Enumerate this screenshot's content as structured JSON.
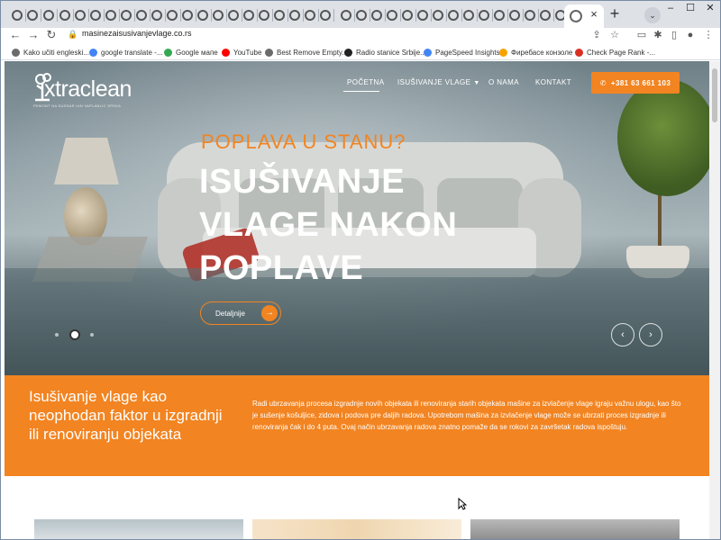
{
  "browser": {
    "url": "masinezaisusivanjevlage.co.rs",
    "new_tab": "+",
    "tab_close": "×",
    "window_controls": [
      "–",
      "☐",
      "✕"
    ],
    "nav": {
      "back": "←",
      "forward": "→",
      "reload": "↻",
      "menu": "⋮"
    }
  },
  "bookmarks": [
    {
      "label": "Kako učiti engleski...",
      "icon": "globe-icon",
      "color": "#6b6b6b"
    },
    {
      "label": "google translate -...",
      "icon": "google-icon",
      "color": "#4285f4"
    },
    {
      "label": "Google мапе",
      "icon": "maps-icon",
      "color": "#34a853"
    },
    {
      "label": "YouTube",
      "icon": "youtube-icon",
      "color": "#ff0000"
    },
    {
      "label": "Best Remove Empty...",
      "icon": "globe-icon",
      "color": "#6b6b6b"
    },
    {
      "label": "Radio stanice Srbije...",
      "icon": "radio-icon",
      "color": "#222222"
    },
    {
      "label": "PageSpeed Insights",
      "icon": "pagespeed-icon",
      "color": "#4285f4"
    },
    {
      "label": "Фиребасе конзоле",
      "icon": "firebase-icon",
      "color": "#f6a300"
    },
    {
      "label": "Check Page Rank -...",
      "icon": "rank-icon",
      "color": "#d93025"
    }
  ],
  "site": {
    "logo_word": "xtraclean",
    "logo_sub": "PEMONT NA SUSSAR IUN VAPLANLIC SPEKA",
    "menu": [
      {
        "label": "POČETNA",
        "active": true
      },
      {
        "label": "ISUŠIVANJE VLAGE",
        "dropdown": true
      },
      {
        "label": "O NAMA"
      },
      {
        "label": "KONTAKT"
      }
    ],
    "phone": "+381 63 661 103",
    "hero": {
      "kicker": "POPLAVA U STANU?",
      "headline": "ISUŠIVANJE VLAGE NAKON POPLAVE",
      "button": "Detaljnije",
      "slider_prev": "‹",
      "slider_next": "›"
    },
    "band": {
      "title": "Isušivanje vlage kao neophodan faktor u izgradnji ili renoviranju objekata",
      "text": "Radi ubrzavanja procesa izgradnje novih objekata ili renoviranja starih objekata mašine za izvlačenje vlage igraju važnu ulogu, kao što je sušenje košuljice, zidova i podova pre daljih radova. Upotrebom mašina za izvlačenje vlage može se ubrzati proces izgradnje ili renoviranja čak i do 4 puta. Ovaj način ubrzavanja radova znatno pomaže da se rokovi za završetak radova ispoštuju."
    }
  },
  "colors": {
    "accent": "#f28421",
    "band": "#f28421"
  }
}
